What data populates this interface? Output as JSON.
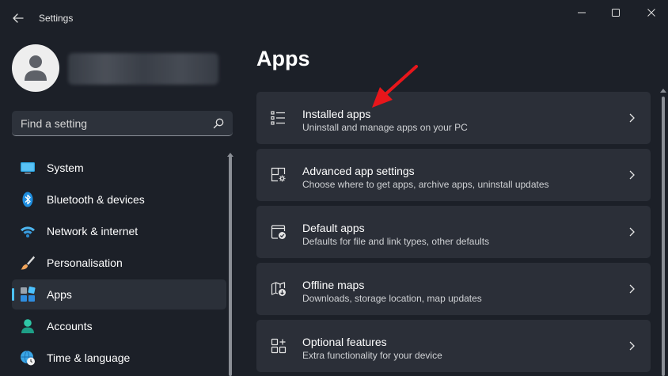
{
  "window": {
    "title": "Settings"
  },
  "search": {
    "placeholder": "Find a setting"
  },
  "sidebar": {
    "items": [
      {
        "label": "System",
        "icon": "monitor-icon"
      },
      {
        "label": "Bluetooth & devices",
        "icon": "bluetooth-icon"
      },
      {
        "label": "Network & internet",
        "icon": "wifi-icon"
      },
      {
        "label": "Personalisation",
        "icon": "brush-icon"
      },
      {
        "label": "Apps",
        "icon": "apps-icon",
        "selected": true
      },
      {
        "label": "Accounts",
        "icon": "person-icon"
      },
      {
        "label": "Time & language",
        "icon": "globe-clock-icon"
      }
    ]
  },
  "main": {
    "title": "Apps",
    "cards": [
      {
        "title": "Installed apps",
        "description": "Uninstall and manage apps on your PC",
        "icon": "list-icon"
      },
      {
        "title": "Advanced app settings",
        "description": "Choose where to get apps, archive apps, uninstall updates",
        "icon": "app-gear-icon"
      },
      {
        "title": "Default apps",
        "description": "Defaults for file and link types, other defaults",
        "icon": "default-app-check-icon"
      },
      {
        "title": "Offline maps",
        "description": "Downloads, storage location, map updates",
        "icon": "map-download-icon"
      },
      {
        "title": "Optional features",
        "description": "Extra functionality for your device",
        "icon": "add-features-icon"
      }
    ]
  },
  "colors": {
    "background": "#1c2028",
    "card": "#2b2f38",
    "accent": "#4cc2ff",
    "arrow": "#e8161b"
  }
}
